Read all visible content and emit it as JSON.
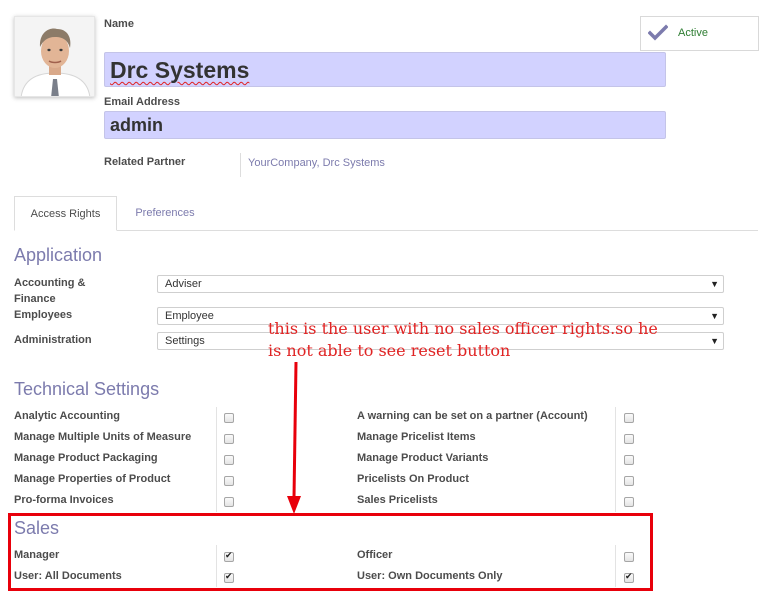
{
  "user": {
    "name_label": "Name",
    "name_value": "Drc Systems",
    "email_label": "Email Address",
    "email_value": "admin",
    "related_partner_label": "Related Partner",
    "related_partner_value": "YourCompany, Drc Systems",
    "status_label": "Active"
  },
  "tabs": [
    {
      "label": "Access Rights",
      "active": true
    },
    {
      "label": "Preferences",
      "active": false
    }
  ],
  "application": {
    "title": "Application",
    "rows": [
      {
        "label_line1": "Accounting &",
        "label_line2": "Finance",
        "value": "Adviser"
      },
      {
        "label": "Employees",
        "value": "Employee"
      },
      {
        "label": "Administration",
        "value": "Settings"
      }
    ]
  },
  "technical": {
    "title": "Technical Settings",
    "left": [
      {
        "label": "Analytic Accounting",
        "checked": false
      },
      {
        "label": "Manage Multiple Units of Measure",
        "checked": false
      },
      {
        "label": "Manage Product Packaging",
        "checked": false
      },
      {
        "label": "Manage Properties of Product",
        "checked": false
      },
      {
        "label": "Pro-forma Invoices",
        "checked": false
      }
    ],
    "right": [
      {
        "label": "A warning can be set on a partner (Account)",
        "checked": false
      },
      {
        "label": "Manage Pricelist Items",
        "checked": false
      },
      {
        "label": "Manage Product Variants",
        "checked": false
      },
      {
        "label": "Pricelists On Product",
        "checked": false
      },
      {
        "label": "Sales Pricelists",
        "checked": false
      }
    ]
  },
  "sales": {
    "title": "Sales",
    "left": [
      {
        "label": "Manager",
        "checked": true
      },
      {
        "label": "User: All Documents",
        "checked": true
      }
    ],
    "right": [
      {
        "label": "Officer",
        "checked": false
      },
      {
        "label": "User: Own Documents Only",
        "checked": true
      }
    ]
  },
  "annotation": {
    "line1": "this is the user with no sales officer rights.so he",
    "line2": "is not able to see reset button",
    "color": "#e02424"
  },
  "colors": {
    "accent": "#7c7bad",
    "field_bg": "#d2d2ff",
    "highlight_box": "#e8000b",
    "active_green": "#2e7d32"
  },
  "icons": {
    "active": "check-icon",
    "select": "caret-down-icon"
  }
}
